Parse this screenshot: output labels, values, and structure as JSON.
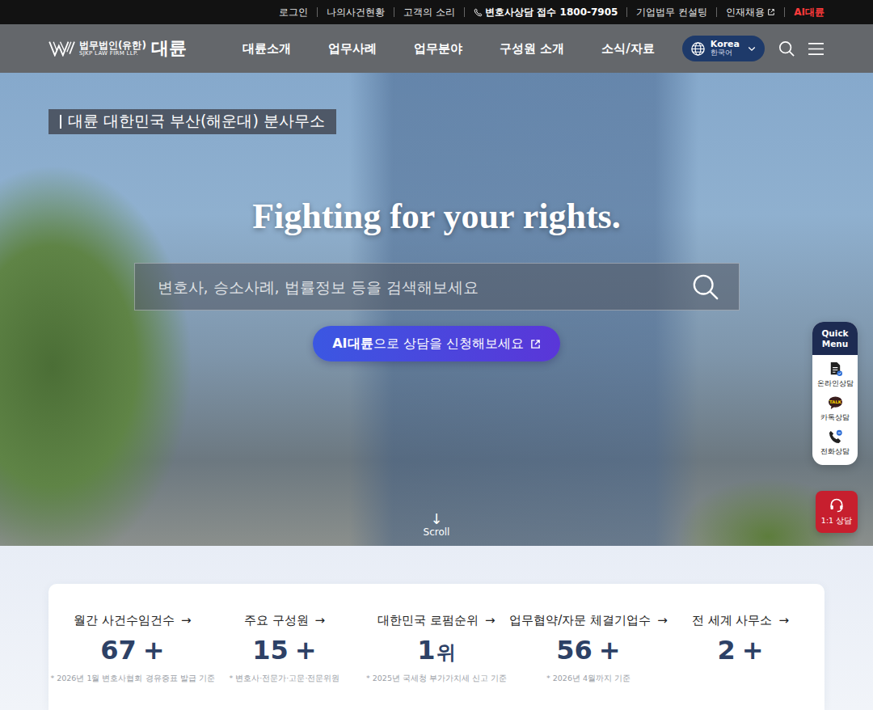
{
  "utility_bar": {
    "links": [
      {
        "label": "로그인",
        "kind": "plain"
      },
      {
        "label": "나의사건현황",
        "kind": "plain"
      },
      {
        "label": "고객의 소리",
        "kind": "plain"
      },
      {
        "label": "변호사상담 접수 1800-7905",
        "kind": "phone"
      },
      {
        "label": "기업법무 컨설팅",
        "kind": "plain"
      },
      {
        "label": "인재채용",
        "kind": "external"
      },
      {
        "label": "AI대륜",
        "kind": "highlight"
      }
    ]
  },
  "header": {
    "logo": {
      "prefix": "법무법인(유한)",
      "english": "SJKP LAW FIRM LLP.",
      "name": "대륜"
    },
    "nav": [
      "대륜소개",
      "업무사례",
      "업무분야",
      "구성원 소개",
      "소식/자료"
    ],
    "language": {
      "label": "Korea",
      "sub": "한국어"
    }
  },
  "hero": {
    "badge": "대륜 대한민국 부산(해운대) 분사무소",
    "title": "Fighting for your rights.",
    "search": {
      "placeholder": "변호사, 승소사례, 법률정보 등을 검색해보세요"
    },
    "cta": {
      "strong": "AI대륜",
      "text": "으로 상담을 신청해보세요"
    },
    "scroll": {
      "arrow": "↓",
      "label": "Scroll"
    }
  },
  "quick_menu": {
    "title_lines": [
      "Quick",
      "Menu"
    ],
    "items": [
      {
        "label": "온라인상담",
        "kind": "form"
      },
      {
        "label": "카톡상담",
        "kind": "kakao",
        "icon_text": "TALK"
      },
      {
        "label": "전화상담",
        "kind": "phone"
      }
    ]
  },
  "consult_button": {
    "label": "1:1 상담"
  },
  "stats": {
    "arrow": "→",
    "items": [
      {
        "label": "월간 사건수임건수",
        "value": "67",
        "suffix": "+",
        "kind": "count",
        "note": "* 2026년 1월 변호사협회 경유증표 발급 기준"
      },
      {
        "label": "주요 구성원",
        "value": "15",
        "suffix": "+",
        "kind": "count",
        "note": "* 변호사·전문가·고문·전문위원"
      },
      {
        "label": "대한민국 로펌순위",
        "value": "1",
        "suffix": "위",
        "kind": "rank",
        "note": "* 2025년 국세청 부가가치세 신고 기준"
      },
      {
        "label": "업무협약/자문 체결기업수",
        "value": "56",
        "suffix": "+",
        "kind": "count",
        "note": "* 2026년 4월까지 기준"
      },
      {
        "label": "전 세계 사무소",
        "value": "2",
        "suffix": "+",
        "kind": "count",
        "note": ""
      }
    ]
  }
}
